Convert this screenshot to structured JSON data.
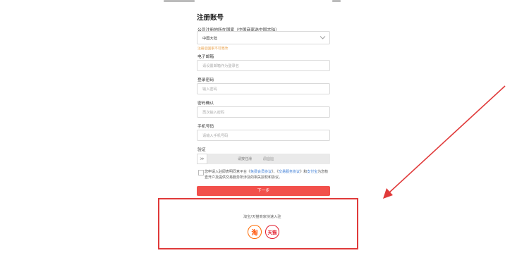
{
  "form": {
    "title": "注册账号",
    "country_label": "公司注册地所在国家（中国商家选中国大陆）",
    "country_value": "中国大陆",
    "country_hint": "注册后国家不可更改",
    "email_label": "电子邮箱",
    "email_placeholder": "请设置邮箱作为登录名",
    "password_label": "登录密码",
    "password_placeholder": "输入密码",
    "confirm_label": "密码确认",
    "confirm_placeholder": "再次输入密码",
    "phone_label": "手机号码",
    "phone_placeholder": "请输入手机号码",
    "verify_label": "验证",
    "verify_handle": "≫",
    "verify_text": "请按住滑",
    "verify_text_tail": "最右边",
    "agree_prefix": "您申请入驻即表明同意平台《",
    "agree_link1": "免费会员协议",
    "agree_mid": "》、《",
    "agree_link2": "交易服务协议",
    "agree_mid2": "》和",
    "agree_link3": "支付宝",
    "agree_suffix": "为您核查开户及提供交易服务所涉及的相关授权和协议。",
    "next_button": "下一步"
  },
  "quick_entry": {
    "text": "淘宝/天猫商家快速入驻",
    "taobao_label": "淘",
    "tmall_label": "天猫"
  },
  "colors": {
    "accent_red": "#f2504b",
    "highlight_box": "#e03a3a",
    "hint_orange": "#e8a04a",
    "link_blue": "#3a7bd5"
  }
}
